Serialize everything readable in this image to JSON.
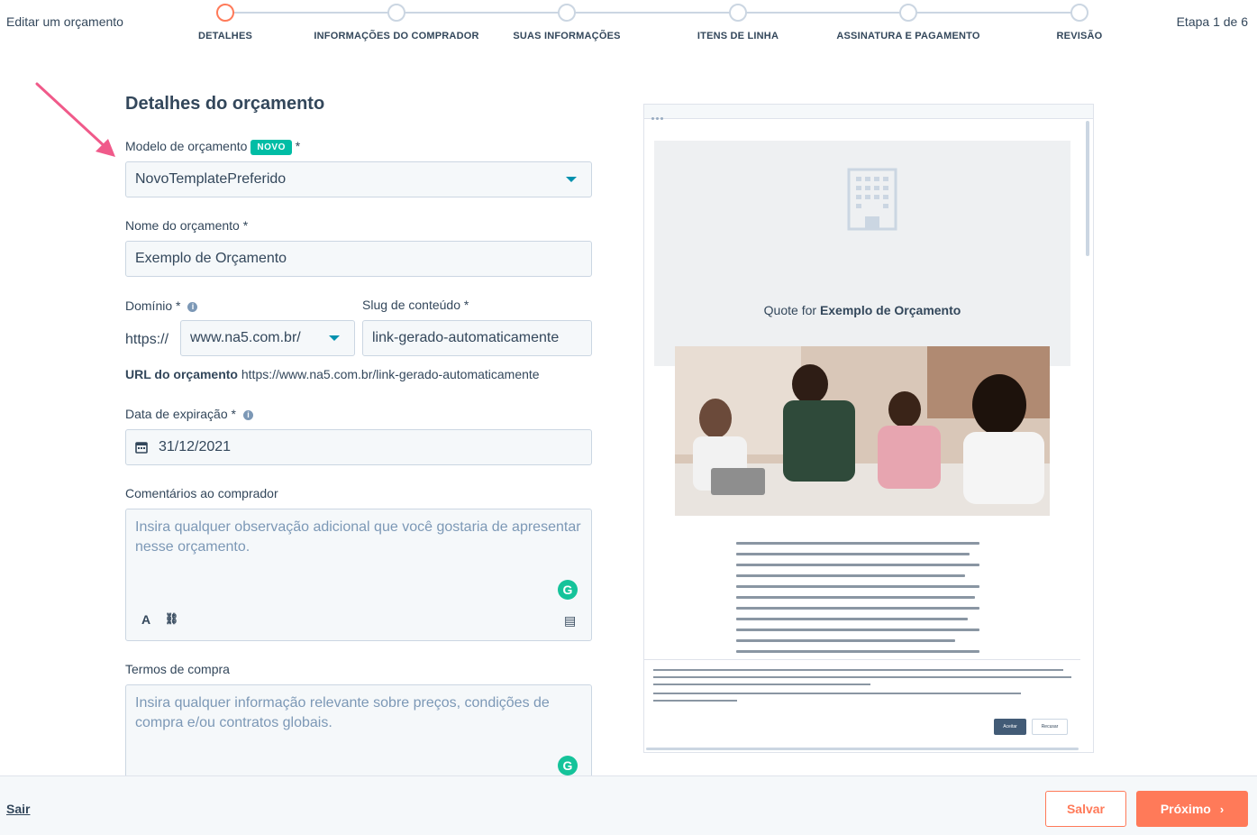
{
  "header": {
    "title": "Editar um orçamento",
    "step_count": "Etapa 1 de 6",
    "steps": [
      {
        "label": "DETALHES",
        "active": true
      },
      {
        "label": "INFORMAÇÕES DO COMPRADOR",
        "active": false
      },
      {
        "label": "SUAS INFORMAÇÕES",
        "active": false
      },
      {
        "label": "ITENS DE LINHA",
        "active": false
      },
      {
        "label": "ASSINATURA E PAGAMENTO",
        "active": false
      },
      {
        "label": "REVISÃO",
        "active": false
      }
    ]
  },
  "form": {
    "section_title": "Detalhes do orçamento",
    "template": {
      "label": "Modelo de orçamento",
      "badge": "NOVO",
      "required": "*",
      "value": "NovoTemplatePreferido"
    },
    "name": {
      "label": "Nome do orçamento *",
      "value": "Exemplo de Orçamento"
    },
    "domain": {
      "label": "Domínio *",
      "prefix": "https://",
      "value": "www.na5.com.br/"
    },
    "slug": {
      "label": "Slug de conteúdo *",
      "value": "link-gerado-automaticamente"
    },
    "url": {
      "label": "URL do orçamento",
      "value": "https://www.na5.com.br/link-gerado-automaticamente"
    },
    "expiration": {
      "label": "Data de expiração *",
      "value": "31/12/2021"
    },
    "comments": {
      "label": "Comentários ao comprador",
      "placeholder": "Insira qualquer observação adicional que você gostaria de apresentar nesse orçamento."
    },
    "terms": {
      "label": "Termos de compra",
      "placeholder": "Insira qualquer informação relevante sobre preços, condições de compra e/ou contratos globais."
    },
    "grammarly_glyph": "G",
    "toolbar": {
      "text_style_glyph": "A",
      "link_glyph": "⛓",
      "snippet_glyph": "▤"
    }
  },
  "preview": {
    "quote_prefix": "Quote for",
    "quote_name": "Exemplo de Orçamento",
    "accept_label": "Aceitar",
    "decline_label": "Recusar"
  },
  "footer": {
    "exit_label": "Sair",
    "save_label": "Salvar",
    "next_label": "Próximo"
  },
  "colors": {
    "accent": "#ff7a59",
    "badge": "#00bda5",
    "grammarly": "#15c39a",
    "text": "#33475b"
  },
  "icons": {
    "arrow": "annotation-arrow-icon",
    "info": "info-icon",
    "calendar": "calendar-icon",
    "dropdown": "chevron-down-icon",
    "next": "chevron-right-icon"
  }
}
